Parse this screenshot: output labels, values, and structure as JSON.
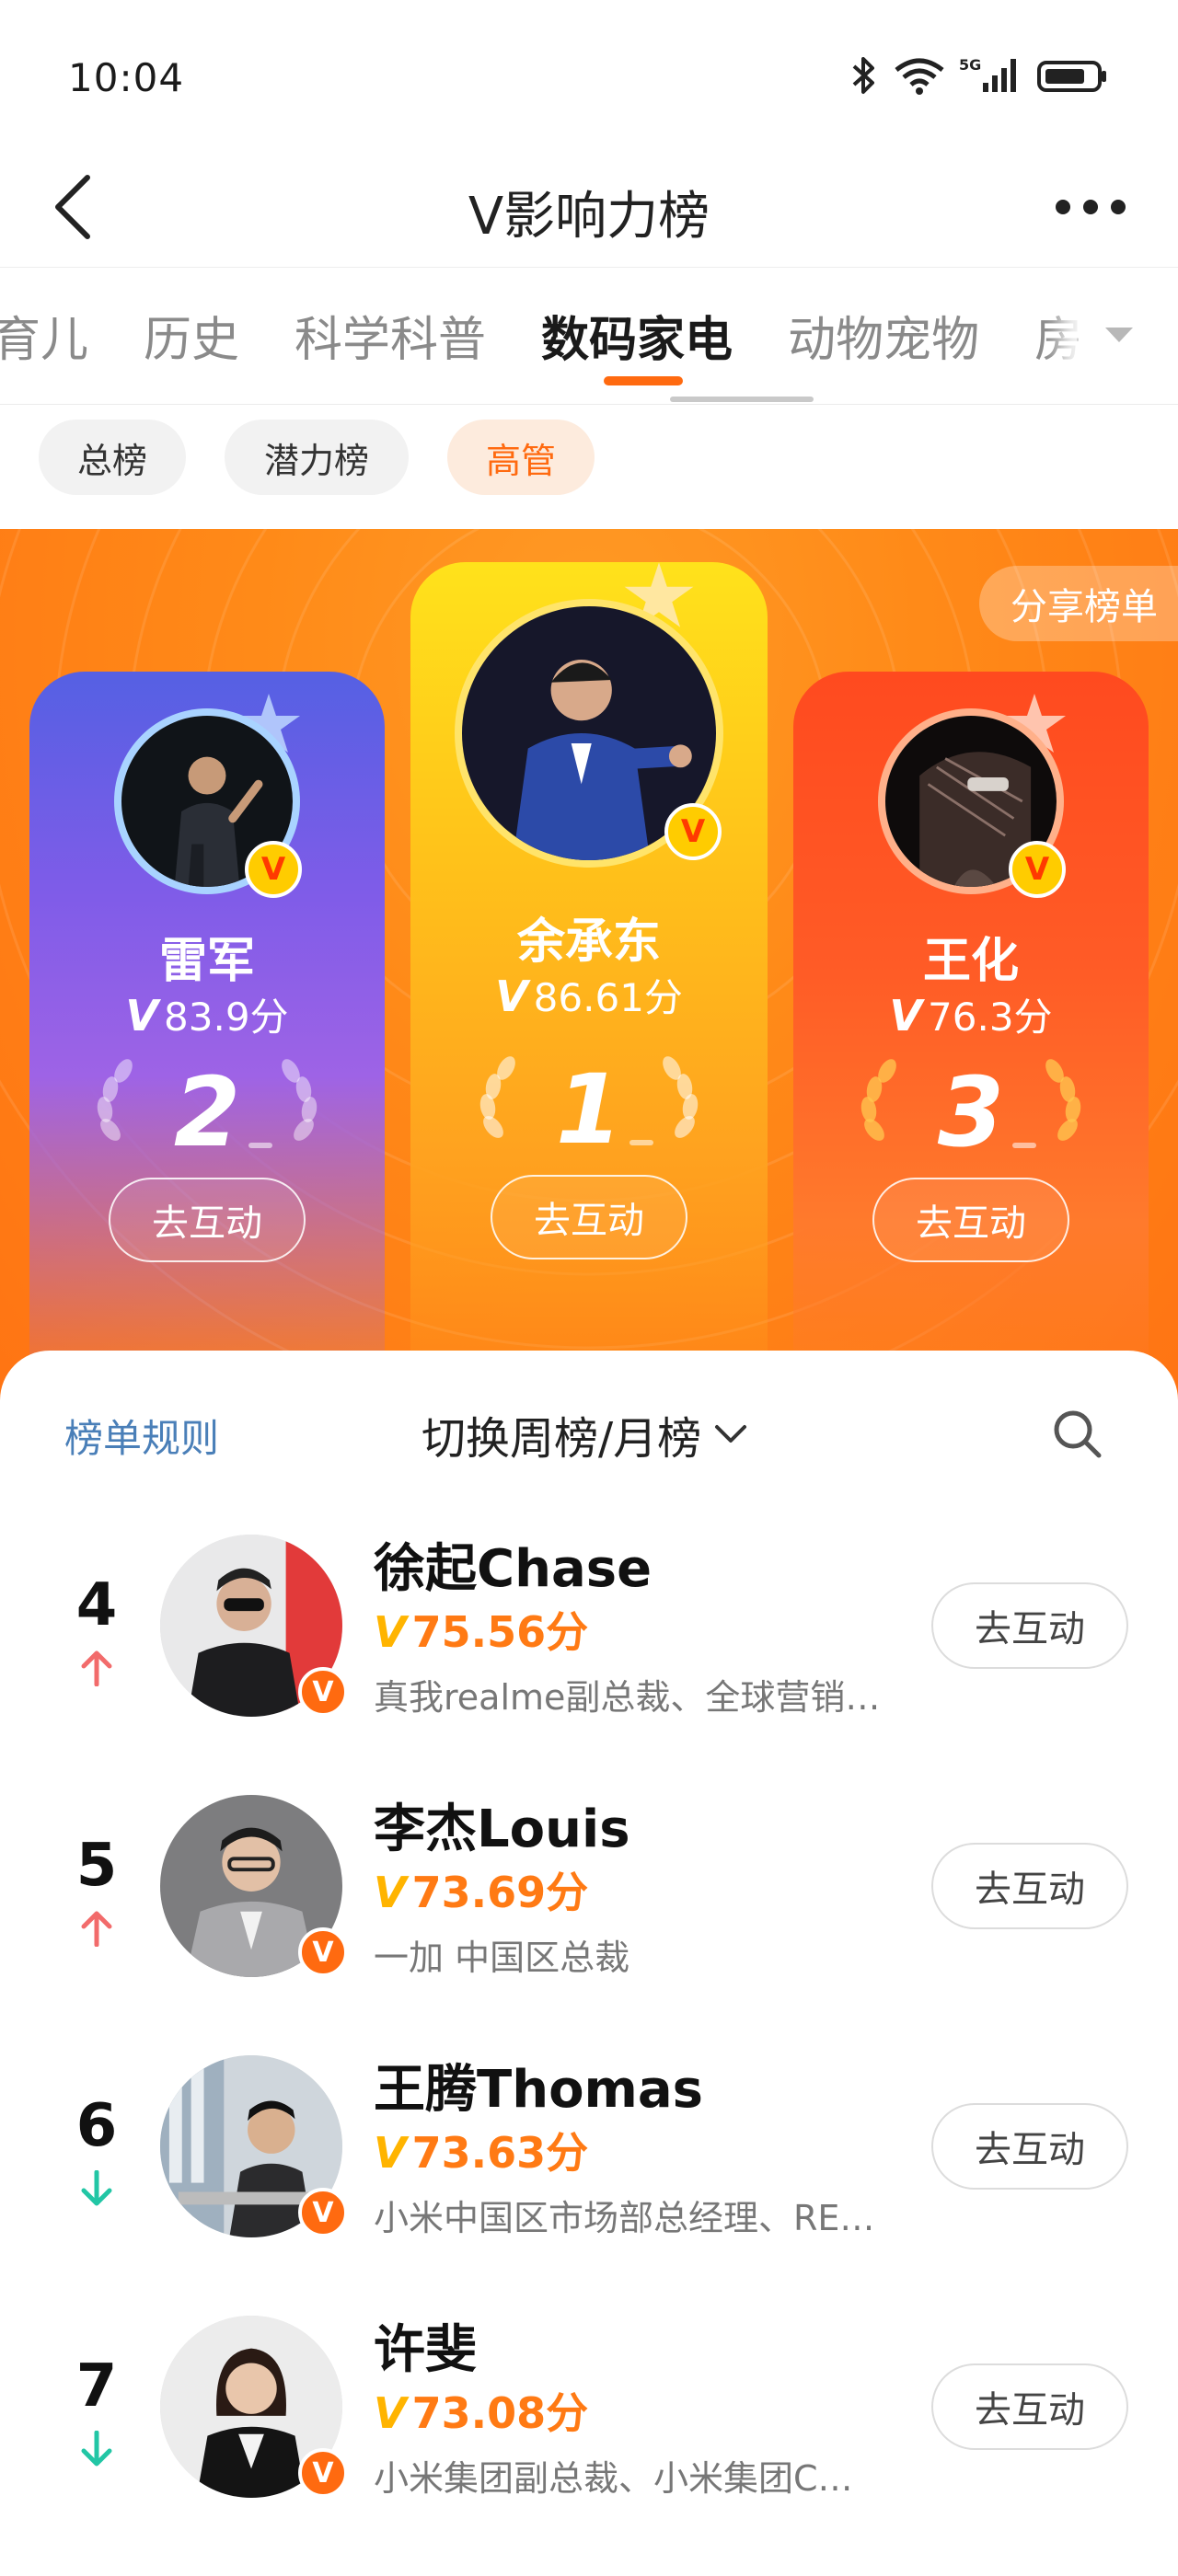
{
  "status_bar": {
    "time": "10:04",
    "network": "5G",
    "battery_icon": "battery-icon"
  },
  "nav": {
    "title": "V影响力榜",
    "back_icon": "back-icon",
    "more_icon": "more-icon"
  },
  "category_tabs": [
    "育儿",
    "历史",
    "科学科普",
    "数码家电",
    "动物宠物",
    "房"
  ],
  "category_active": "数码家电",
  "filter_pills": [
    {
      "label": "总榜",
      "active": false
    },
    {
      "label": "潜力榜",
      "active": false
    },
    {
      "label": "高管",
      "active": true
    }
  ],
  "hero": {
    "share_label": "分享榜单",
    "top3": [
      {
        "rank": "2",
        "name": "雷军",
        "score_v": "V",
        "score": "83.9分",
        "button": "去互动"
      },
      {
        "rank": "1",
        "name": "余承东",
        "score_v": "V",
        "score": "86.61分",
        "button": "去互动"
      },
      {
        "rank": "3",
        "name": "王化",
        "score_v": "V",
        "score": "76.3分",
        "button": "去互动"
      }
    ]
  },
  "list": {
    "rules_label": "榜单规则",
    "switch_label": "切换周榜/月榜",
    "rows": [
      {
        "rank": "4",
        "trend": "up",
        "name": "徐起Chase",
        "score_v": "V",
        "score": "75.56分",
        "desc": "真我realme副总裁、全球营销…",
        "button": "去互动"
      },
      {
        "rank": "5",
        "trend": "up",
        "name": "李杰Louis",
        "score_v": "V",
        "score": "73.69分",
        "desc": "一加 中国区总裁",
        "button": "去互动"
      },
      {
        "rank": "6",
        "trend": "down",
        "name": "王腾Thomas",
        "score_v": "V",
        "score": "73.63分",
        "desc": "小米中国区市场部总经理、RE…",
        "button": "去互动"
      },
      {
        "rank": "7",
        "trend": "down",
        "name": "许斐",
        "score_v": "V",
        "score": "73.08分",
        "desc": "小米集团副总裁、小米集团C…",
        "button": "去互动"
      }
    ]
  },
  "colors": {
    "accent": "#ff6a10",
    "trend_up": "#f26b6b",
    "trend_down": "#22c6a5",
    "link": "#4a7fb8"
  }
}
